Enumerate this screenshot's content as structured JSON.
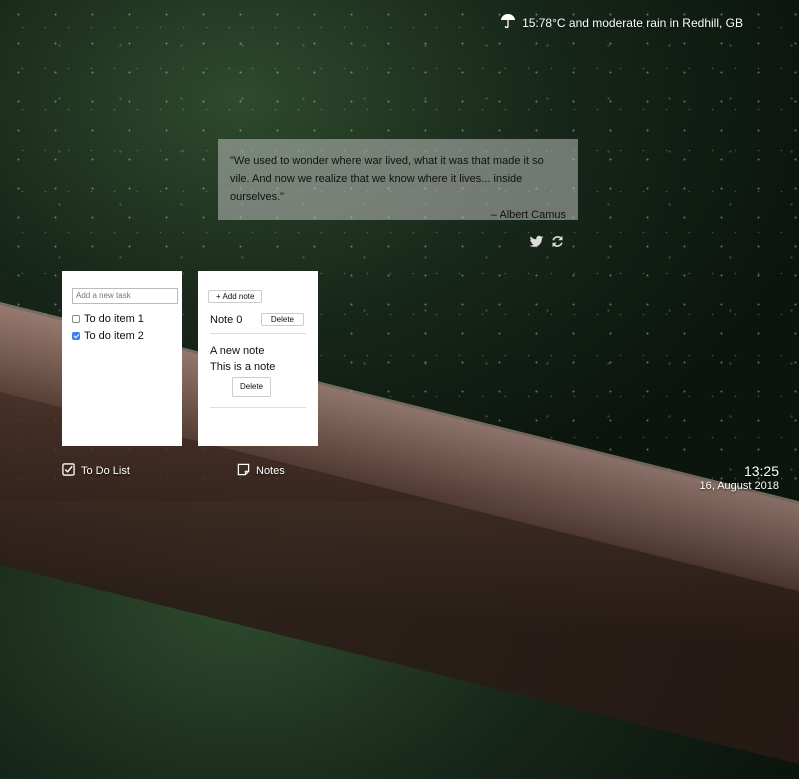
{
  "weather": {
    "icon": "umbrella-icon",
    "text": "15:78°C and moderate rain in Redhill, GB"
  },
  "quote": {
    "text": "\"We used to wonder where war lived, what it was that made it so vile. And now we realize that we know where it lives... inside ourselves.\"",
    "author": "– Albert Camus",
    "actions": [
      "twitter-icon",
      "refresh-icon"
    ]
  },
  "todo": {
    "placeholder": "Add a new task",
    "items": [
      {
        "label": "To do item 1",
        "checked": false
      },
      {
        "label": "To do item 2",
        "checked": true
      }
    ]
  },
  "notes": {
    "add_label": "+ Add note",
    "note0": {
      "title": "Note 0",
      "delete_label": "Delete"
    },
    "note1": {
      "title": "A new note",
      "body": "This is a note",
      "delete_label": "Delete"
    }
  },
  "dock": {
    "todo_label": "To Do List",
    "notes_label": "Notes"
  },
  "clock": {
    "time": "13:25",
    "date": "16, August 2018"
  },
  "colors": {
    "checkbox_accent": "#3b82f6",
    "quote_bg": "rgba(190,190,190,0.55)"
  }
}
